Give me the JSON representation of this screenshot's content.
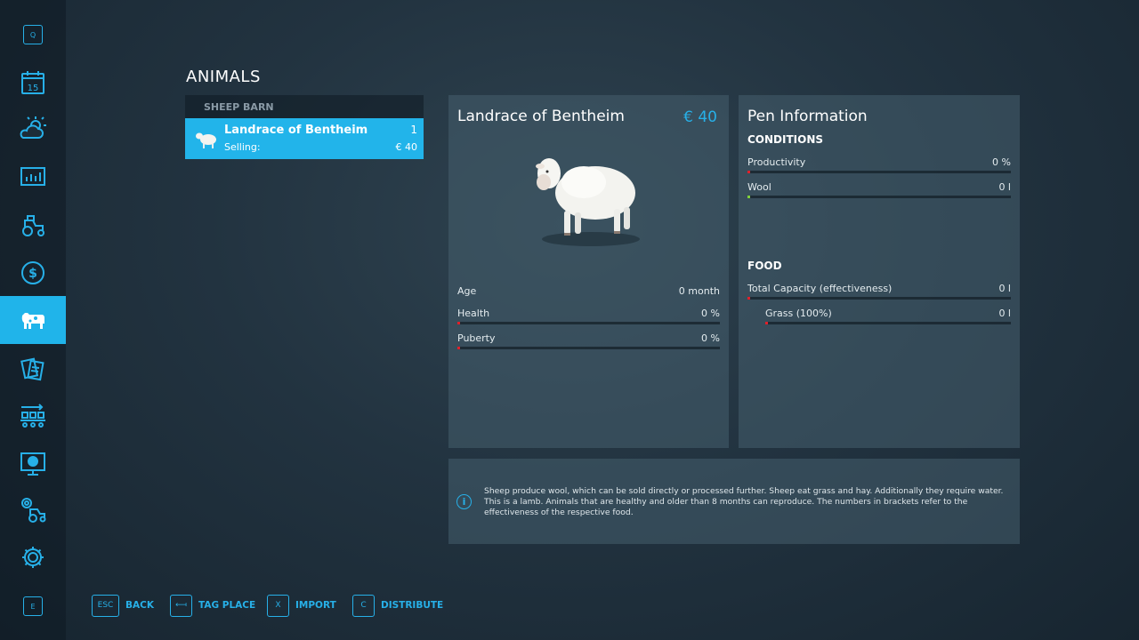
{
  "sidebar": {
    "top_key": "Q",
    "bottom_key": "E",
    "calendar_day": "15",
    "items": [
      {
        "icon": "calendar-icon"
      },
      {
        "icon": "weather-icon"
      },
      {
        "icon": "statistics-icon"
      },
      {
        "icon": "tractor-icon"
      },
      {
        "icon": "finances-icon"
      },
      {
        "icon": "animals-icon",
        "active": true
      },
      {
        "icon": "contracts-icon"
      },
      {
        "icon": "production-icon"
      },
      {
        "icon": "help-icon"
      },
      {
        "icon": "vehicle-settings-icon"
      },
      {
        "icon": "settings-icon"
      }
    ]
  },
  "page": {
    "title": "ANIMALS"
  },
  "list": {
    "header": "SHEEP BARN",
    "items": [
      {
        "name": "Landrace of Bentheim",
        "count": "1",
        "sell_label": "Selling:",
        "sell_price": "€ 40"
      }
    ]
  },
  "detail": {
    "name": "Landrace of Bentheim",
    "price": "€ 40",
    "stats": [
      {
        "label": "Age",
        "value": "0 month",
        "bar": false
      },
      {
        "label": "Health",
        "value": "0 %",
        "bar": true,
        "level": 0
      },
      {
        "label": "Puberty",
        "value": "0 %",
        "bar": true,
        "level": 0
      }
    ]
  },
  "pen": {
    "title": "Pen Information",
    "conditions_header": "CONDITIONS",
    "conditions": [
      {
        "label": "Productivity",
        "value": "0 %",
        "level": 0
      },
      {
        "label": "Wool",
        "value": "0 l",
        "level": 0
      }
    ],
    "food_header": "FOOD",
    "food": [
      {
        "label": "Total Capacity (effectiveness)",
        "value": "0 l",
        "level": 0
      },
      {
        "label": "Grass (100%)",
        "value": "0 l",
        "level": 0
      }
    ]
  },
  "info": {
    "text": "Sheep produce wool, which can be sold directly or processed further. Sheep eat grass and hay. Additionally they require water. This is a lamb. Animals that are healthy and older than 8 months can reproduce. The numbers in brackets refer to the effectiveness of the respective food."
  },
  "footer": [
    {
      "key": "ESC",
      "label": "BACK"
    },
    {
      "key": "⟻",
      "label": "TAG PLACE"
    },
    {
      "key": "X",
      "label": "IMPORT"
    },
    {
      "key": "C",
      "label": "DISTRIBUTE"
    }
  ],
  "colors": {
    "accent": "#22b4ea",
    "bar_red": "#e0202a",
    "bar_green": "#7fd03a",
    "panel": "#3f5563"
  }
}
